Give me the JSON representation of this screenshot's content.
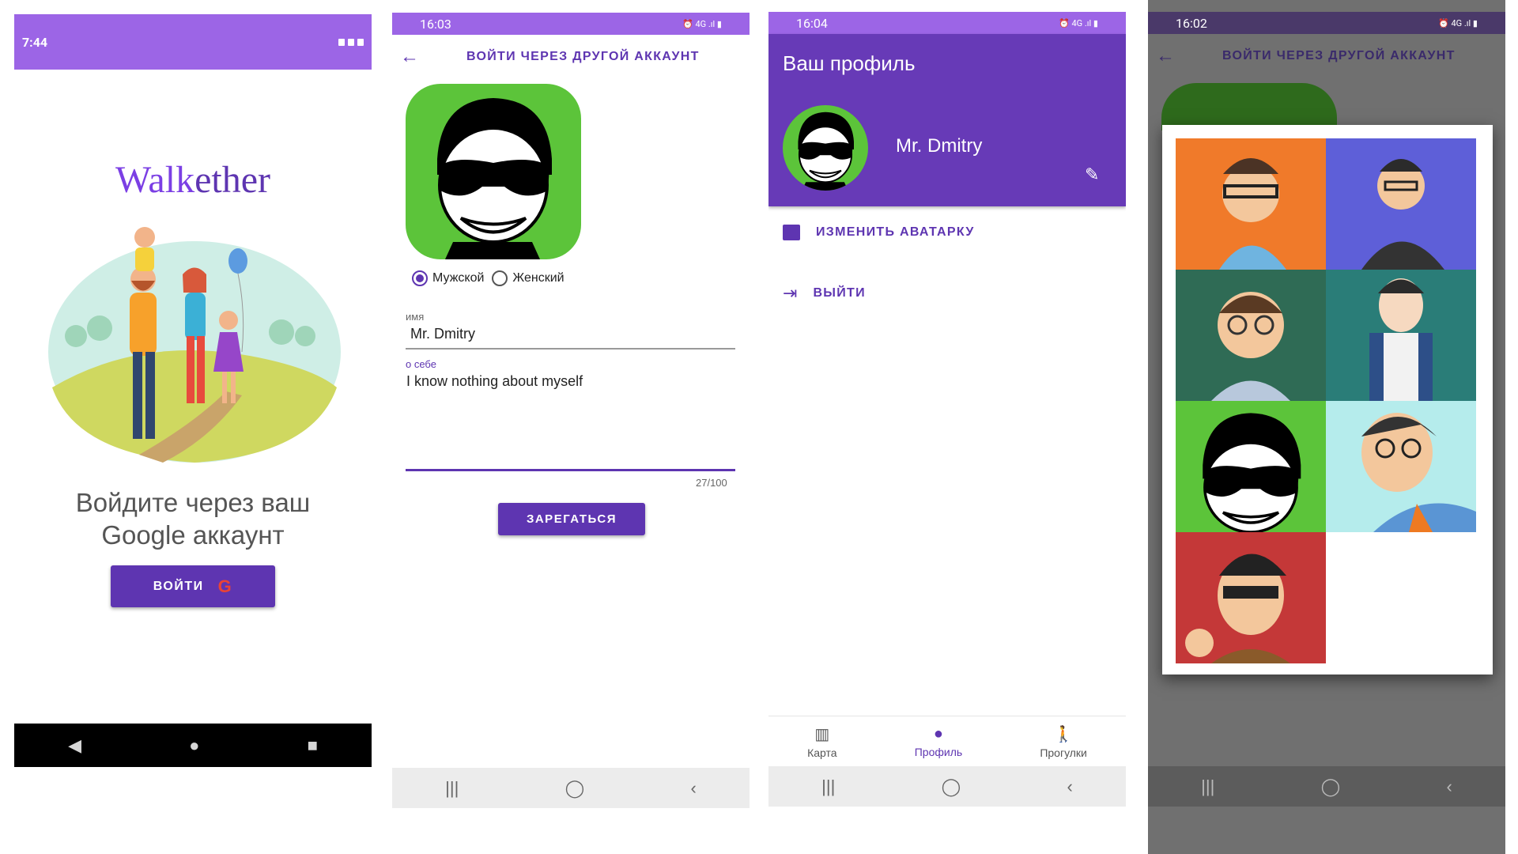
{
  "colors": {
    "accent": "#5e35b1",
    "statusbar": "#9c65e6",
    "header": "#673ab7",
    "nav_dark": "#000000",
    "nav_light": "#ececec",
    "overlay": "#707070"
  },
  "screen1": {
    "status_time": "7:44",
    "logo_walk": "Walk",
    "logo_ether": "ether",
    "prompt_line1": "Войдите через ваш",
    "prompt_line2": "Google аккаунт",
    "login_label": "ВОЙТИ",
    "google_letter": "G",
    "nav": [
      "◀",
      "●",
      "■"
    ]
  },
  "screen2": {
    "status_time": "16:03",
    "status_icons": "⏰ 4G .ıl ▮",
    "title": "ВОЙТИ ЧЕРЕЗ ДРУГОЙ АККАУНТ",
    "gender_male": "Мужской",
    "gender_female": "Женский",
    "name_label": "имя",
    "name_value": "Mr. Dmitry",
    "about_label": "о себе",
    "about_value": "I know nothing about myself",
    "counter": "27/100",
    "register_label": "ЗАРЕГАТЬСЯ",
    "nav": [
      "|||",
      "◯",
      "‹"
    ]
  },
  "screen3": {
    "status_time": "16:04",
    "status_icons": "⏰ 4G .ıl ▮",
    "title": "Ваш профиль",
    "user_name": "Mr. Dmitry",
    "change_avatar": "ИЗМЕНИТЬ АВАТАРКУ",
    "logout": "ВЫЙТИ",
    "tabs": [
      {
        "label": "Карта",
        "icon": "map-icon"
      },
      {
        "label": "Профиль",
        "icon": "person-icon"
      },
      {
        "label": "Прогулки",
        "icon": "walk-icon"
      }
    ],
    "nav": [
      "|||",
      "◯",
      "‹"
    ]
  },
  "screen4": {
    "status_time": "16:02",
    "status_icons": "⏰ 4G .ıl ▮",
    "title": "ВОЙТИ ЧЕРЕЗ ДРУГОЙ АККАУНТ",
    "avatar_backgrounds": [
      "#f07a2a",
      "#5e5fd8",
      "#2f6b55",
      "#2a7d78",
      "#5cc43a",
      "#b5ecec",
      "#c43838"
    ],
    "nav": [
      "|||",
      "◯",
      "‹"
    ]
  }
}
